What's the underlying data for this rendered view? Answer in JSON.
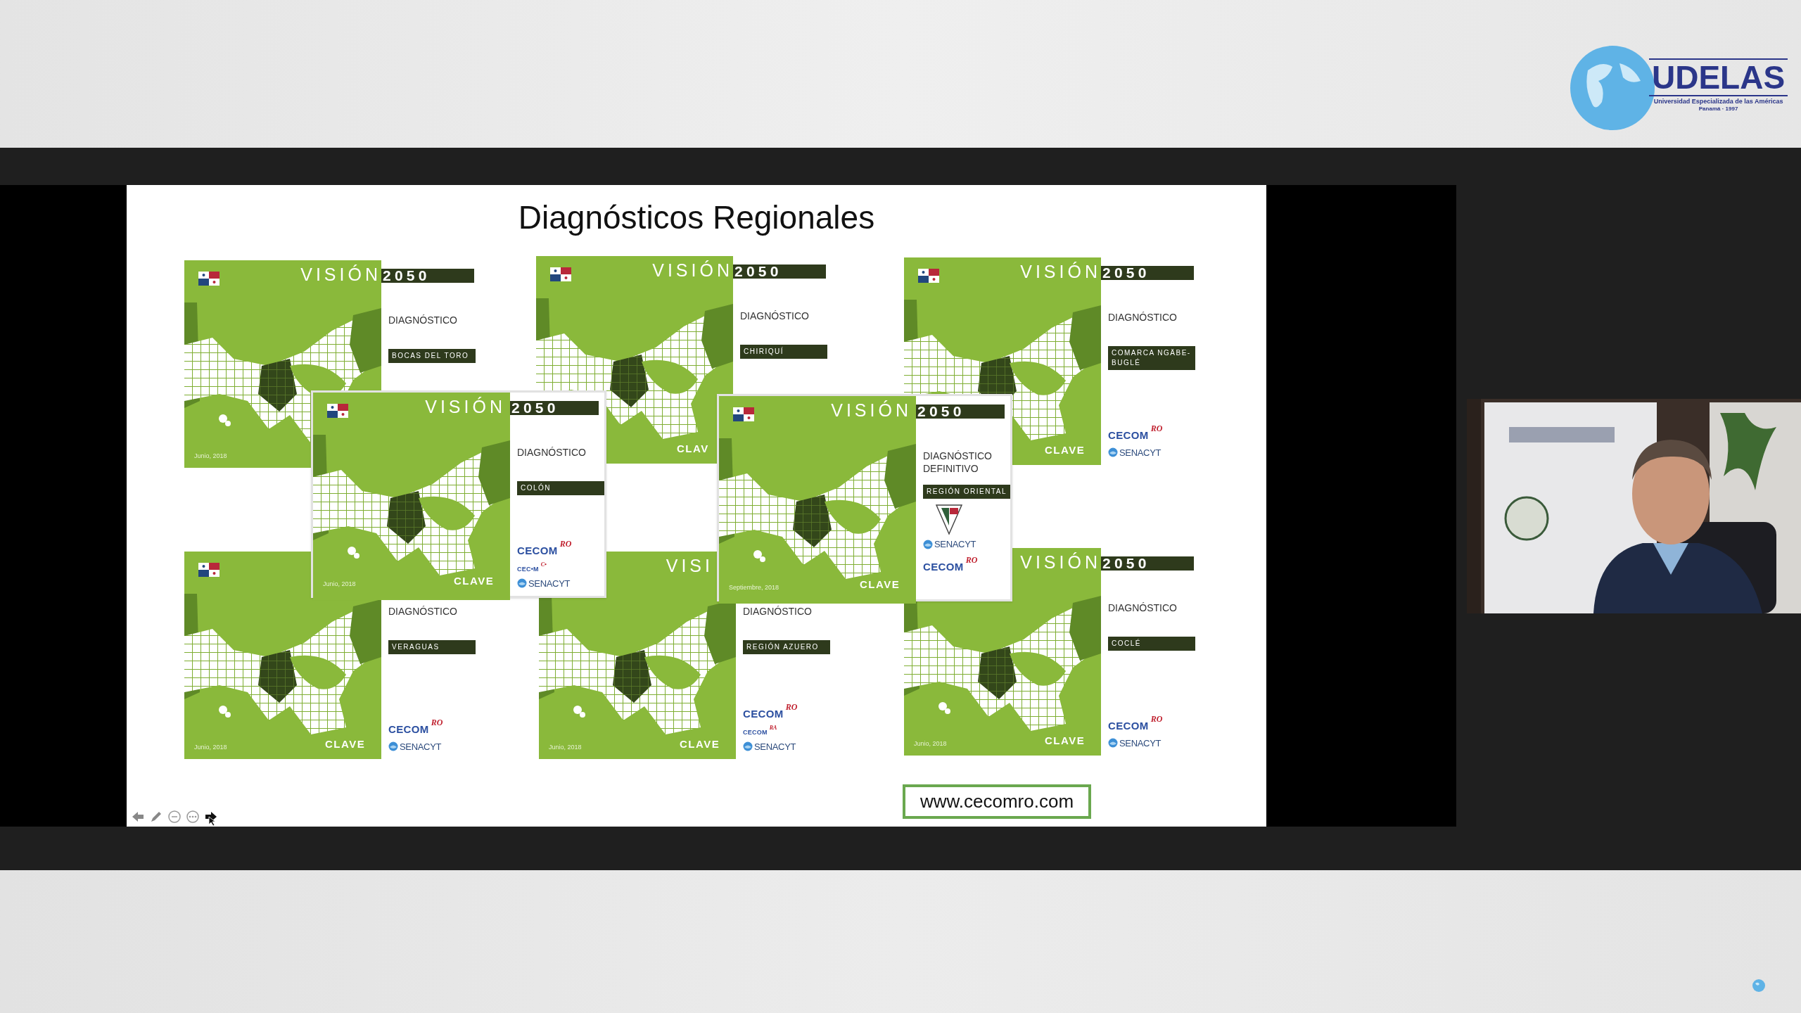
{
  "header": {
    "logo": {
      "name": "UDELAS",
      "tagline": "Universidad Especializada de las Américas",
      "place": "Panamá · 1997"
    }
  },
  "slide": {
    "title": "Diagnósticos Regionales",
    "covers": [
      {
        "title": "VISIÓN",
        "year": "2050",
        "doc": "DIAGNÓSTICO",
        "region": "BOCAS DEL TORO",
        "date": "Junio, 2018"
      },
      {
        "title": "VISIÓN",
        "year": "2050",
        "doc": "DIAGNÓSTICO",
        "region": "CHIRIQUÍ",
        "publisher": "CLAV"
      },
      {
        "title": "VISIÓN",
        "year": "2050",
        "doc": "DIAGNÓSTICO",
        "region": "COMARCA NGÄBE-BUGLÉ",
        "publisher": "CLAVE",
        "logos": [
          {
            "kind": "cecom",
            "name": "CECOM",
            "suffix": "RO"
          },
          {
            "kind": "senacyt",
            "name": "SENACYT"
          }
        ]
      },
      {
        "doc": "DIAGNÓSTICO",
        "region": "VERAGUAS",
        "date": "Junio, 2018",
        "publisher": "CLAVE",
        "logos": [
          {
            "kind": "cecom",
            "name": "CECOM",
            "suffix": "RO"
          },
          {
            "kind": "senacyt",
            "name": "SENACYT"
          }
        ]
      },
      {
        "title": "VISI",
        "doc": "DIAGNÓSTICO",
        "region": "REGIÓN AZUERO",
        "date": "Junio, 2018",
        "publisher": "CLAVE",
        "logos": [
          {
            "kind": "cecom",
            "name": "CECOM",
            "suffix": "RO"
          },
          {
            "kind": "cecom-small",
            "name": "CECOM",
            "suffix": "RA"
          },
          {
            "kind": "senacyt",
            "name": "SENACYT"
          }
        ]
      },
      {
        "title": "VISIÓN",
        "year": "2050",
        "doc": "DIAGNÓSTICO",
        "region": "COCLÉ",
        "date": "Junio, 2018",
        "publisher": "CLAVE",
        "logos": [
          {
            "kind": "cecom",
            "name": "CECOM",
            "suffix": "RO"
          },
          {
            "kind": "senacyt",
            "name": "SENACYT"
          }
        ]
      },
      {
        "title": "VISIÓN",
        "year": "2050",
        "doc": "DIAGNÓSTICO",
        "region": "COLÓN",
        "date": "Junio, 2018",
        "publisher": "CLAVE",
        "logos": [
          {
            "kind": "cecom",
            "name": "CECOM",
            "suffix": "RO"
          },
          {
            "kind": "cecom-small",
            "name": "CEC•M",
            "suffix": "C•"
          },
          {
            "kind": "senacyt",
            "name": "SENACYT"
          }
        ]
      },
      {
        "title": "VISIÓN",
        "year": "2050",
        "doc": "DIAGNÓSTICO DEFINITIVO",
        "region": "REGIÓN ORIENTAL",
        "date": "Septiembre, 2018",
        "publisher": "CLAVE",
        "logos": [
          {
            "kind": "shield"
          },
          {
            "kind": "senacyt",
            "name": "SENACYT"
          },
          {
            "kind": "cecom",
            "name": "CECOM",
            "suffix": "RO"
          }
        ]
      }
    ],
    "url": "www.cecomro.com",
    "toolbar": [
      {
        "kind": "back"
      },
      {
        "kind": "pen"
      },
      {
        "kind": "zoom"
      },
      {
        "kind": "more"
      },
      {
        "kind": "next"
      }
    ]
  }
}
